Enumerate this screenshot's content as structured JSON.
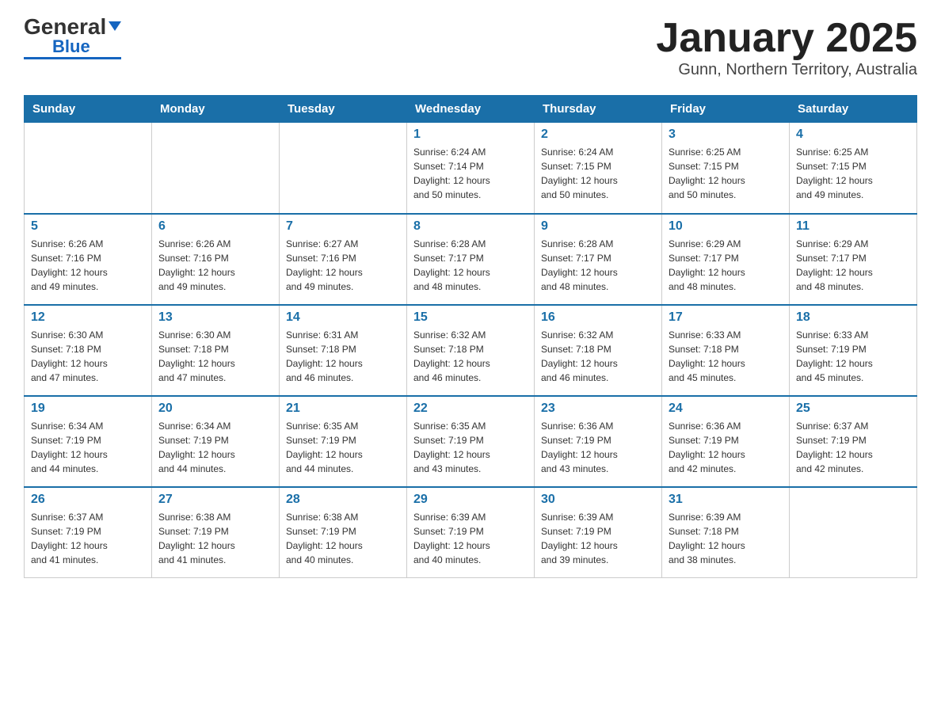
{
  "header": {
    "logo_general": "General",
    "logo_blue": "Blue",
    "month_year": "January 2025",
    "location": "Gunn, Northern Territory, Australia"
  },
  "weekdays": [
    "Sunday",
    "Monday",
    "Tuesday",
    "Wednesday",
    "Thursday",
    "Friday",
    "Saturday"
  ],
  "weeks": [
    [
      {
        "day": "",
        "info": ""
      },
      {
        "day": "",
        "info": ""
      },
      {
        "day": "",
        "info": ""
      },
      {
        "day": "1",
        "info": "Sunrise: 6:24 AM\nSunset: 7:14 PM\nDaylight: 12 hours\nand 50 minutes."
      },
      {
        "day": "2",
        "info": "Sunrise: 6:24 AM\nSunset: 7:15 PM\nDaylight: 12 hours\nand 50 minutes."
      },
      {
        "day": "3",
        "info": "Sunrise: 6:25 AM\nSunset: 7:15 PM\nDaylight: 12 hours\nand 50 minutes."
      },
      {
        "day": "4",
        "info": "Sunrise: 6:25 AM\nSunset: 7:15 PM\nDaylight: 12 hours\nand 49 minutes."
      }
    ],
    [
      {
        "day": "5",
        "info": "Sunrise: 6:26 AM\nSunset: 7:16 PM\nDaylight: 12 hours\nand 49 minutes."
      },
      {
        "day": "6",
        "info": "Sunrise: 6:26 AM\nSunset: 7:16 PM\nDaylight: 12 hours\nand 49 minutes."
      },
      {
        "day": "7",
        "info": "Sunrise: 6:27 AM\nSunset: 7:16 PM\nDaylight: 12 hours\nand 49 minutes."
      },
      {
        "day": "8",
        "info": "Sunrise: 6:28 AM\nSunset: 7:17 PM\nDaylight: 12 hours\nand 48 minutes."
      },
      {
        "day": "9",
        "info": "Sunrise: 6:28 AM\nSunset: 7:17 PM\nDaylight: 12 hours\nand 48 minutes."
      },
      {
        "day": "10",
        "info": "Sunrise: 6:29 AM\nSunset: 7:17 PM\nDaylight: 12 hours\nand 48 minutes."
      },
      {
        "day": "11",
        "info": "Sunrise: 6:29 AM\nSunset: 7:17 PM\nDaylight: 12 hours\nand 48 minutes."
      }
    ],
    [
      {
        "day": "12",
        "info": "Sunrise: 6:30 AM\nSunset: 7:18 PM\nDaylight: 12 hours\nand 47 minutes."
      },
      {
        "day": "13",
        "info": "Sunrise: 6:30 AM\nSunset: 7:18 PM\nDaylight: 12 hours\nand 47 minutes."
      },
      {
        "day": "14",
        "info": "Sunrise: 6:31 AM\nSunset: 7:18 PM\nDaylight: 12 hours\nand 46 minutes."
      },
      {
        "day": "15",
        "info": "Sunrise: 6:32 AM\nSunset: 7:18 PM\nDaylight: 12 hours\nand 46 minutes."
      },
      {
        "day": "16",
        "info": "Sunrise: 6:32 AM\nSunset: 7:18 PM\nDaylight: 12 hours\nand 46 minutes."
      },
      {
        "day": "17",
        "info": "Sunrise: 6:33 AM\nSunset: 7:18 PM\nDaylight: 12 hours\nand 45 minutes."
      },
      {
        "day": "18",
        "info": "Sunrise: 6:33 AM\nSunset: 7:19 PM\nDaylight: 12 hours\nand 45 minutes."
      }
    ],
    [
      {
        "day": "19",
        "info": "Sunrise: 6:34 AM\nSunset: 7:19 PM\nDaylight: 12 hours\nand 44 minutes."
      },
      {
        "day": "20",
        "info": "Sunrise: 6:34 AM\nSunset: 7:19 PM\nDaylight: 12 hours\nand 44 minutes."
      },
      {
        "day": "21",
        "info": "Sunrise: 6:35 AM\nSunset: 7:19 PM\nDaylight: 12 hours\nand 44 minutes."
      },
      {
        "day": "22",
        "info": "Sunrise: 6:35 AM\nSunset: 7:19 PM\nDaylight: 12 hours\nand 43 minutes."
      },
      {
        "day": "23",
        "info": "Sunrise: 6:36 AM\nSunset: 7:19 PM\nDaylight: 12 hours\nand 43 minutes."
      },
      {
        "day": "24",
        "info": "Sunrise: 6:36 AM\nSunset: 7:19 PM\nDaylight: 12 hours\nand 42 minutes."
      },
      {
        "day": "25",
        "info": "Sunrise: 6:37 AM\nSunset: 7:19 PM\nDaylight: 12 hours\nand 42 minutes."
      }
    ],
    [
      {
        "day": "26",
        "info": "Sunrise: 6:37 AM\nSunset: 7:19 PM\nDaylight: 12 hours\nand 41 minutes."
      },
      {
        "day": "27",
        "info": "Sunrise: 6:38 AM\nSunset: 7:19 PM\nDaylight: 12 hours\nand 41 minutes."
      },
      {
        "day": "28",
        "info": "Sunrise: 6:38 AM\nSunset: 7:19 PM\nDaylight: 12 hours\nand 40 minutes."
      },
      {
        "day": "29",
        "info": "Sunrise: 6:39 AM\nSunset: 7:19 PM\nDaylight: 12 hours\nand 40 minutes."
      },
      {
        "day": "30",
        "info": "Sunrise: 6:39 AM\nSunset: 7:19 PM\nDaylight: 12 hours\nand 39 minutes."
      },
      {
        "day": "31",
        "info": "Sunrise: 6:39 AM\nSunset: 7:18 PM\nDaylight: 12 hours\nand 38 minutes."
      },
      {
        "day": "",
        "info": ""
      }
    ]
  ]
}
